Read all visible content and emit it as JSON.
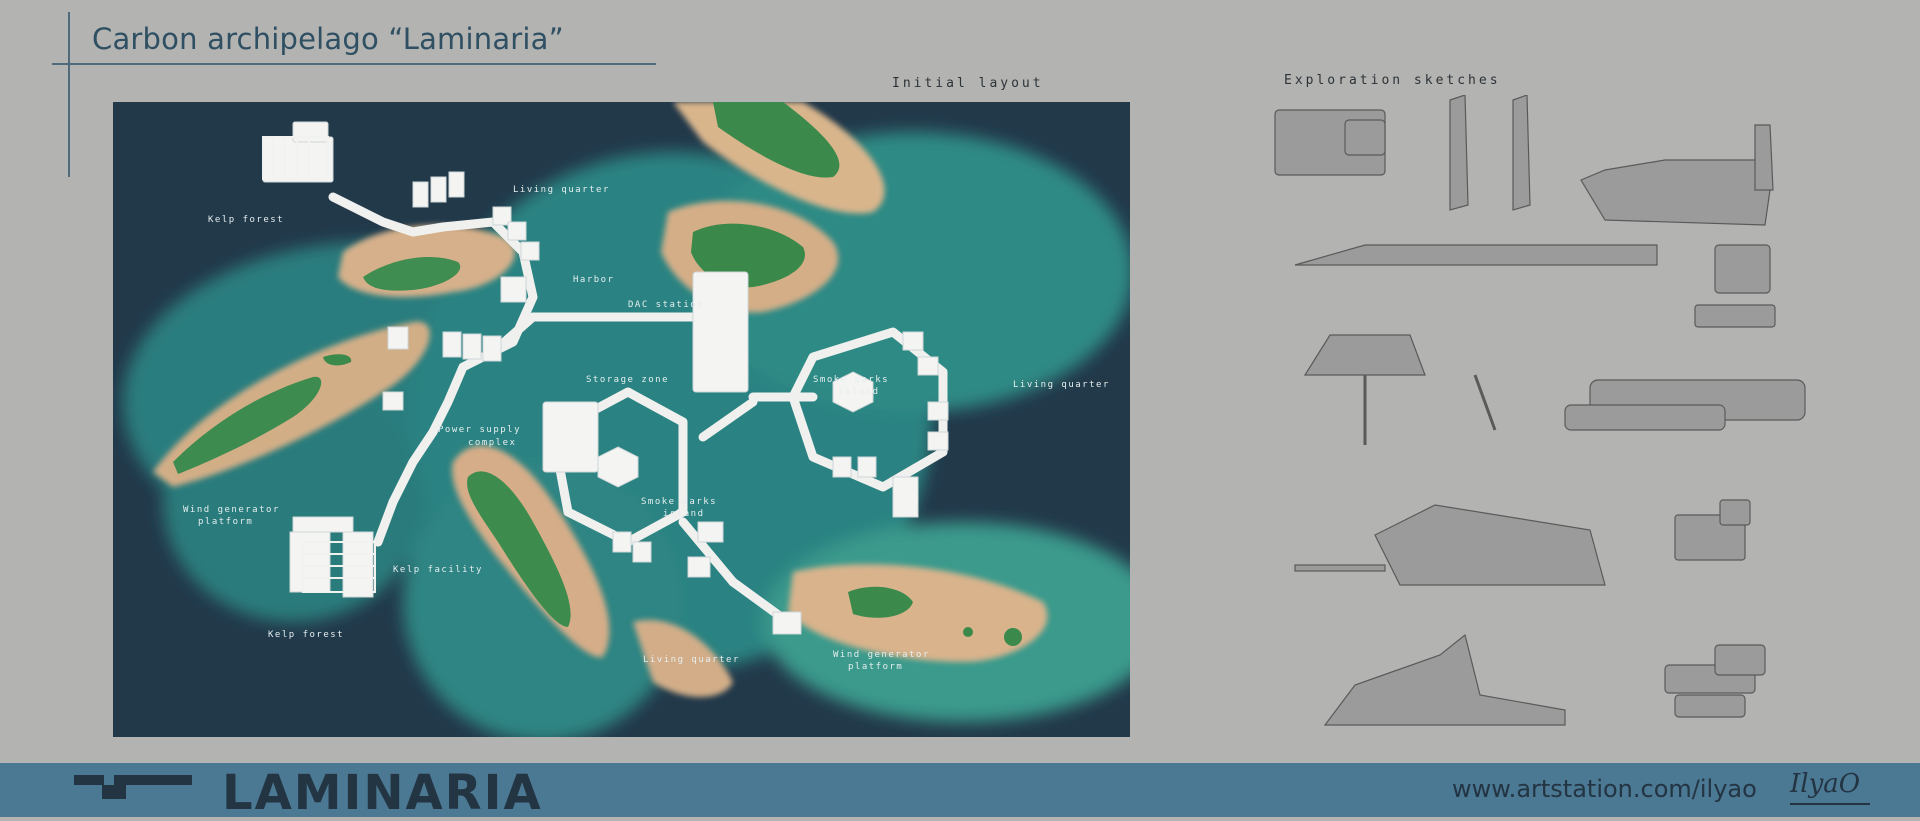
{
  "page": {
    "title": "Carbon archipelago “Laminaria”",
    "initial_layout_label": "Initial layout",
    "exploration_label": "Exploration sketches"
  },
  "map": {
    "labels": {
      "kelp_forest_nw": "Kelp forest",
      "living_quarter_n": "Living quarter",
      "harbor": "Harbor",
      "dac_station": "DAC station",
      "storage_zone": "Storage zone",
      "power_supply": "Power supply",
      "power_supply_2": "complex",
      "smoke_parks_e": "Smoke parks",
      "smoke_parks_e2": "island",
      "living_quarter_e": "Living quarter",
      "smoke_parks_s": "Smoke parks",
      "smoke_parks_s2": "island",
      "wind_platform_w": "Wind generator",
      "wind_platform_w2": "platform",
      "kelp_facility": "Kelp facility",
      "kelp_forest_sw": "Kelp forest",
      "living_quarter_s": "Living quarter",
      "wind_platform_s": "Wind generator",
      "wind_platform_s2": "platform"
    },
    "colors": {
      "deep_water": "#22394a",
      "shallow_water": "#2f8b86",
      "sand": "#d8b890",
      "vegetation": "#3b8a4c",
      "structures": "#f2f2f0"
    }
  },
  "sketches": {
    "color": "#9a9a9a",
    "outline": "#555555"
  },
  "footer": {
    "brand": "LAMINARIA",
    "url": "www.artstation.com/ilyao",
    "signature": "IlyaO",
    "colors": {
      "bar": "#4b7892",
      "text": "#233443"
    }
  }
}
